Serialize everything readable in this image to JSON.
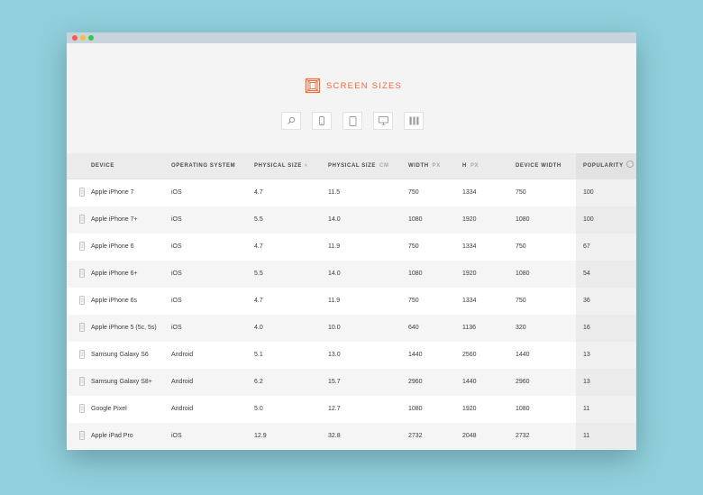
{
  "window": {
    "controls": [
      "close",
      "minimize",
      "maximize"
    ]
  },
  "brand": {
    "title": "SCREEN SIZES",
    "color": "#f26b3a",
    "icon": "screen-sizes-logo-icon"
  },
  "toolbar": {
    "buttons": [
      {
        "icon": "search-icon"
      },
      {
        "icon": "phone-icon"
      },
      {
        "icon": "tablet-icon"
      },
      {
        "icon": "monitor-icon"
      },
      {
        "icon": "grid-icon"
      }
    ]
  },
  "table": {
    "headers": {
      "device": "DEVICE",
      "os": "OPERATING SYSTEM",
      "physical_size": "PHYSICAL SIZE",
      "physical_size_sort": "˄",
      "physical_size_cm": "PHYSICAL SIZE",
      "physical_size_cm_unit": "CM",
      "width": "WIDTH",
      "width_unit": "PX",
      "height": "H",
      "height_unit": "PX",
      "device_width": "DEVICE WIDTH",
      "popularity": "POPULARITY"
    },
    "rows": [
      {
        "device": "Apple iPhone 7",
        "os": "iOS",
        "inches": "4.7",
        "cm": "11.5",
        "width": "750",
        "height": "1334",
        "device_width": "750",
        "popularity": "100"
      },
      {
        "device": "Apple iPhone 7+",
        "os": "iOS",
        "inches": "5.5",
        "cm": "14.0",
        "width": "1080",
        "height": "1920",
        "device_width": "1080",
        "popularity": "100"
      },
      {
        "device": "Apple iPhone 6",
        "os": "iOS",
        "inches": "4.7",
        "cm": "11.9",
        "width": "750",
        "height": "1334",
        "device_width": "750",
        "popularity": "67"
      },
      {
        "device": "Apple iPhone 6+",
        "os": "iOS",
        "inches": "5.5",
        "cm": "14.0",
        "width": "1080",
        "height": "1920",
        "device_width": "1080",
        "popularity": "54"
      },
      {
        "device": "Apple iPhone 6s",
        "os": "iOS",
        "inches": "4.7",
        "cm": "11.9",
        "width": "750",
        "height": "1334",
        "device_width": "750",
        "popularity": "36"
      },
      {
        "device": "Apple iPhone 5 (5c, 5s)",
        "os": "iOS",
        "inches": "4.0",
        "cm": "10.0",
        "width": "640",
        "height": "1136",
        "device_width": "320",
        "popularity": "16"
      },
      {
        "device": "Samsung Galaxy S6",
        "os": "Android",
        "inches": "5.1",
        "cm": "13.0",
        "width": "1440",
        "height": "2560",
        "device_width": "1440",
        "popularity": "13"
      },
      {
        "device": "Samsung Galaxy S8+",
        "os": "Android",
        "inches": "6.2",
        "cm": "15.7",
        "width": "2960",
        "height": "1440",
        "device_width": "2960",
        "popularity": "13"
      },
      {
        "device": "Google Pixel",
        "os": "Android",
        "inches": "5.0",
        "cm": "12.7",
        "width": "1080",
        "height": "1920",
        "device_width": "1080",
        "popularity": "11"
      },
      {
        "device": "Apple iPad Pro",
        "os": "iOS",
        "inches": "12.9",
        "cm": "32.8",
        "width": "2732",
        "height": "2048",
        "device_width": "2732",
        "popularity": "11"
      }
    ]
  }
}
